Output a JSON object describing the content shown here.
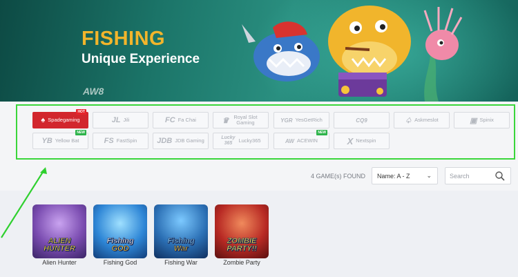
{
  "banner": {
    "title": "FISHING",
    "subtitle": "Unique Experience",
    "brand": "AW8"
  },
  "providers": [
    {
      "name": "Spadegaming",
      "icon": "spade-icon",
      "tag": "HOT",
      "active": true
    },
    {
      "name": "Jili",
      "icon": "JL"
    },
    {
      "name": "Fa Chai",
      "icon": "FC"
    },
    {
      "name": "Royal Slot Gaming",
      "icon": "crown-icon"
    },
    {
      "name": "YesGetRich",
      "icon": "YGR"
    },
    {
      "name": "CQ9",
      "icon": "CQ9"
    },
    {
      "name": "Askmeslot",
      "icon": "spade-outline-icon"
    },
    {
      "name": "Spinix",
      "icon": "cube-icon"
    },
    {
      "name": "Yellow Bat",
      "icon": "YB",
      "tag": "NEW"
    },
    {
      "name": "FastSpin",
      "icon": "FS"
    },
    {
      "name": "JDB Gaming",
      "icon": "JDB"
    },
    {
      "name": "Lucky365",
      "icon": "Lucky 365"
    },
    {
      "name": "ACEWIN",
      "icon": "AW",
      "tag": "NEW"
    },
    {
      "name": "Nextspin",
      "icon": "X"
    }
  ],
  "filter": {
    "count_text": "4 GAME(s) FOUND",
    "sort_label": "Name: A - Z",
    "search_placeholder": "Search"
  },
  "games": [
    {
      "name": "Alien Hunter",
      "art": [
        "ALIEN",
        "HUNTER"
      ],
      "color": "#8a5fb8"
    },
    {
      "name": "Fishing God",
      "art": [
        "Fishing",
        "GOD"
      ],
      "color": "#2e86d6"
    },
    {
      "name": "Fishing War",
      "art": [
        "Fishing",
        "War"
      ],
      "color": "#2b6fb4"
    },
    {
      "name": "Zombie Party",
      "art": [
        "ZOMBIE",
        "PARTY!!"
      ],
      "color": "#b82a24"
    }
  ],
  "colors": {
    "accent": "#d2262d",
    "highlight": "#3ad63a",
    "banner_title": "#f2b52b"
  }
}
